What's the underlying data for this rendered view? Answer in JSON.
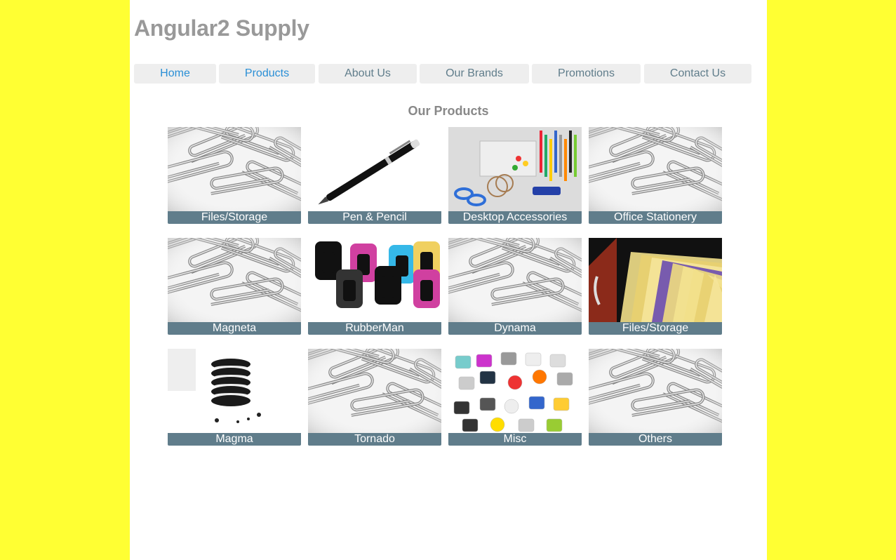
{
  "site": {
    "title": "Angular2 Supply"
  },
  "nav": {
    "items": [
      {
        "label": "Home"
      },
      {
        "label": "Products"
      },
      {
        "label": "About Us"
      },
      {
        "label": "Our Brands"
      },
      {
        "label": "Promotions"
      },
      {
        "label": "Contact Us"
      }
    ]
  },
  "section": {
    "title": "Our Products"
  },
  "products": [
    {
      "label": "Files/Storage",
      "image": "paperclips"
    },
    {
      "label": "Pen & Pencil",
      "image": "pen"
    },
    {
      "label": "Desktop Accessories",
      "image": "desk-organizer"
    },
    {
      "label": "Office Stationery",
      "image": "paperclips"
    },
    {
      "label": "Magneta",
      "image": "paperclips"
    },
    {
      "label": "RubberMan",
      "image": "ink-stamps"
    },
    {
      "label": "Dynama",
      "image": "paperclips"
    },
    {
      "label": "Files/Storage",
      "image": "file-drawer"
    },
    {
      "label": "Magma",
      "image": "cookies"
    },
    {
      "label": "Tornado",
      "image": "paperclips"
    },
    {
      "label": "Misc",
      "image": "promo-items"
    },
    {
      "label": "Others",
      "image": "paperclips"
    }
  ],
  "colors": {
    "background": "#ffff33",
    "caption": "#607d8b",
    "nav_active": "#2a8fd6",
    "nav_text": "#607d8b"
  }
}
